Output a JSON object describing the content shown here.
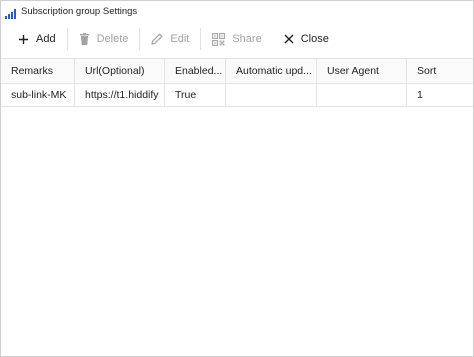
{
  "window": {
    "title": "Subscription group Settings"
  },
  "toolbar": {
    "add_label": "Add",
    "delete_label": "Delete",
    "edit_label": "Edit",
    "share_label": "Share",
    "close_label": "Close"
  },
  "icons": {
    "app": "bar-chart-icon",
    "add": "plus-icon",
    "delete": "trash-icon",
    "edit": "pencil-icon",
    "share": "qr-code-icon",
    "close": "close-icon"
  },
  "table": {
    "columns": [
      "Remarks",
      "Url(Optional)",
      "Enabled...",
      "Automatic upd...",
      "User Agent",
      "Sort"
    ],
    "rows": [
      [
        "sub-link-MK",
        "https://t1.hiddify",
        "True",
        "",
        "",
        "1"
      ]
    ]
  },
  "colors": {
    "app_icon_blue": "#1e5fd6",
    "disabled_text": "#a3a3a3",
    "grid_line": "#e4e4e4"
  }
}
